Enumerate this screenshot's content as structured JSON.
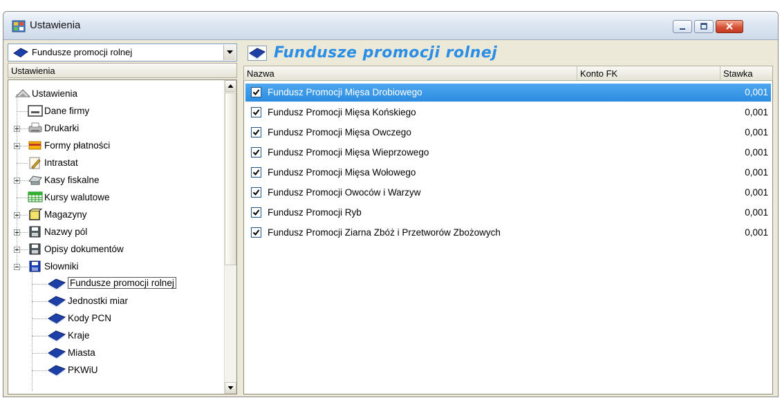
{
  "window": {
    "title": "Ustawienia"
  },
  "left": {
    "combo_value": "Fundusze promocji rolnej",
    "header": "Ustawienia",
    "tree": [
      {
        "label": "Ustawienia",
        "icon": "settings-icon"
      },
      {
        "label": "Dane firmy",
        "icon": "company-card-icon"
      },
      {
        "label": "Drukarki",
        "icon": "printer-icon"
      },
      {
        "label": "Formy płatności",
        "icon": "payment-icon"
      },
      {
        "label": "Intrastat",
        "icon": "document-pencil-icon"
      },
      {
        "label": "Kasy fiskalne",
        "icon": "cash-register-icon"
      },
      {
        "label": "Kursy walutowe",
        "icon": "table-grid-icon"
      },
      {
        "label": "Magazyny",
        "icon": "warehouse-icon"
      },
      {
        "label": "Nazwy pól",
        "icon": "floppy-icon"
      },
      {
        "label": "Opisy dokumentów",
        "icon": "floppy-icon"
      },
      {
        "label": "Słowniki",
        "icon": "floppy-blue-icon"
      },
      {
        "label": "Fundusze promocji rolnej",
        "icon": "book-icon"
      },
      {
        "label": "Jednostki miar",
        "icon": "book-icon"
      },
      {
        "label": "Kody PCN",
        "icon": "book-icon"
      },
      {
        "label": "Kraje",
        "icon": "book-icon"
      },
      {
        "label": "Miasta",
        "icon": "book-icon"
      },
      {
        "label": "PKWiU",
        "icon": "book-icon"
      }
    ]
  },
  "right": {
    "title": "Fundusze promocji rolnej",
    "columns": [
      "Nazwa",
      "Konto FK",
      "Stawka"
    ],
    "rows": [
      {
        "checked": true,
        "name": "Fundusz Promocji Mięsa Drobiowego",
        "konto": "",
        "rate": "0,001"
      },
      {
        "checked": true,
        "name": "Fundusz Promocji Mięsa Końskiego",
        "konto": "",
        "rate": "0,001"
      },
      {
        "checked": true,
        "name": "Fundusz Promocji Mięsa Owczego",
        "konto": "",
        "rate": "0,001"
      },
      {
        "checked": true,
        "name": "Fundusz Promocji Mięsa Wieprzowego",
        "konto": "",
        "rate": "0,001"
      },
      {
        "checked": true,
        "name": "Fundusz Promocji Mięsa Wołowego",
        "konto": "",
        "rate": "0,001"
      },
      {
        "checked": true,
        "name": "Fundusz Promocji Owoców i Warzyw",
        "konto": "",
        "rate": "0,001"
      },
      {
        "checked": true,
        "name": "Fundusz Promocji Ryb",
        "konto": "",
        "rate": "0,001"
      },
      {
        "checked": true,
        "name": "Fundusz Promocji Ziarna Zbóż i Przetworów Zbożowych",
        "konto": "",
        "rate": "0,001"
      }
    ]
  },
  "colors": {
    "selection": "#3a9ae8",
    "title_accent": "#2a8ee6"
  }
}
